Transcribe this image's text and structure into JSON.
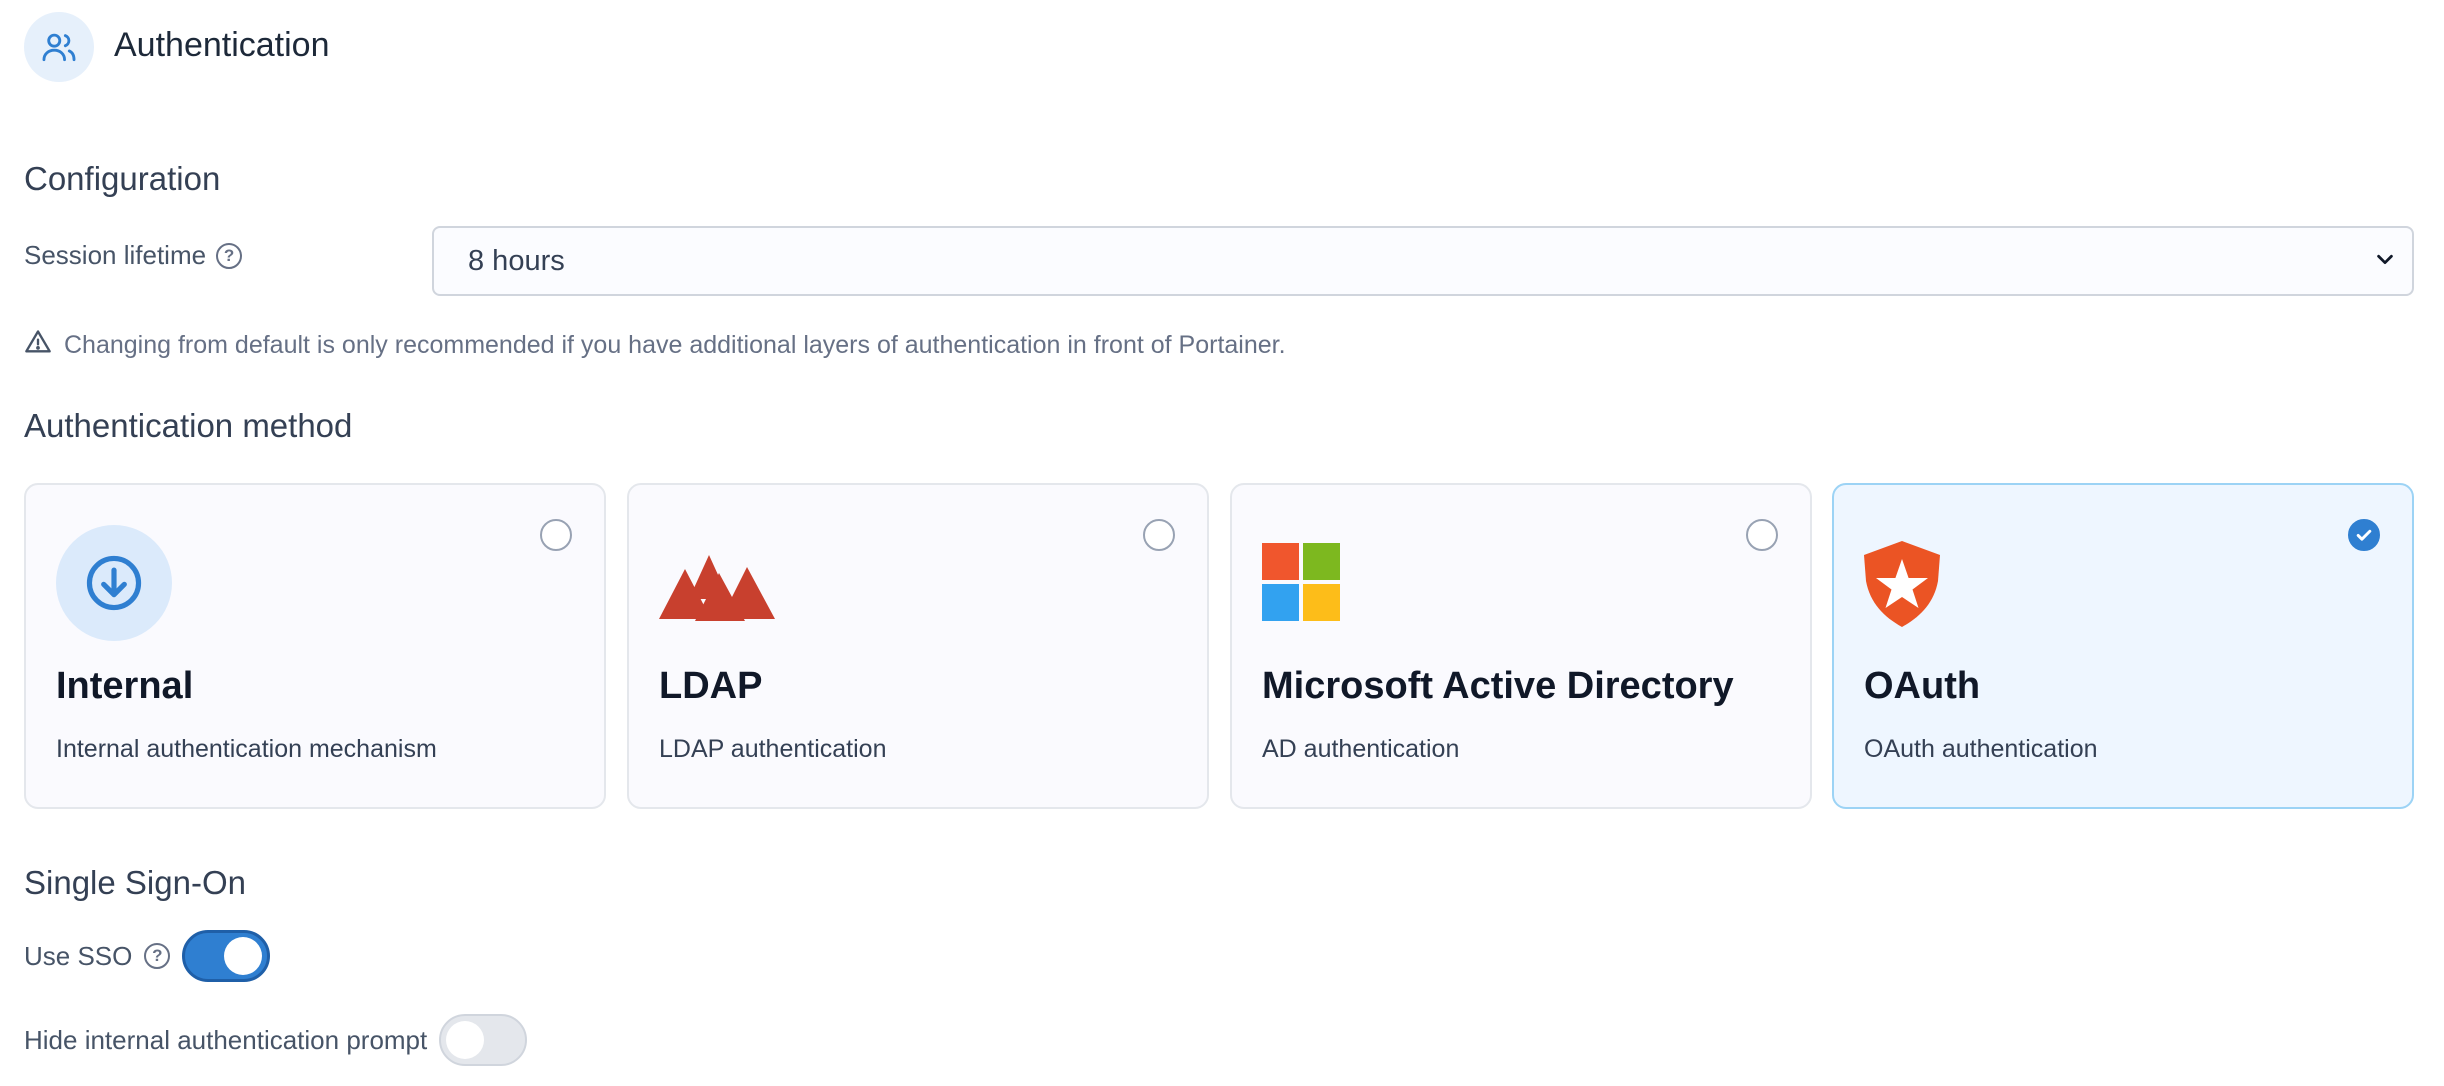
{
  "header": {
    "title": "Authentication",
    "icon": "users-icon"
  },
  "configuration": {
    "title": "Configuration",
    "session_label": "Session lifetime",
    "session_value": "8 hours",
    "warning": "Changing from default is only recommended if you have additional layers of authentication in front of Portainer."
  },
  "auth_method": {
    "title": "Authentication method",
    "cards": [
      {
        "title": "Internal",
        "desc": "Internal authentication mechanism",
        "icon": "download-circle-icon",
        "selected": false
      },
      {
        "title": "LDAP",
        "desc": "LDAP authentication",
        "icon": "ldap-logo",
        "selected": false
      },
      {
        "title": "Microsoft Active Directory",
        "desc": "AD authentication",
        "icon": "microsoft-logo",
        "selected": false
      },
      {
        "title": "OAuth",
        "desc": "OAuth authentication",
        "icon": "oauth-logo",
        "selected": true
      }
    ]
  },
  "sso": {
    "title": "Single Sign-On",
    "use_sso_label": "Use SSO",
    "use_sso_on": true,
    "hide_prompt_label": "Hide internal authentication prompt",
    "hide_prompt_on": false
  },
  "colors": {
    "accent": "#2f7fd1",
    "selected_card_bg": "#eef6ff",
    "selected_card_border": "#9cd3f5"
  }
}
